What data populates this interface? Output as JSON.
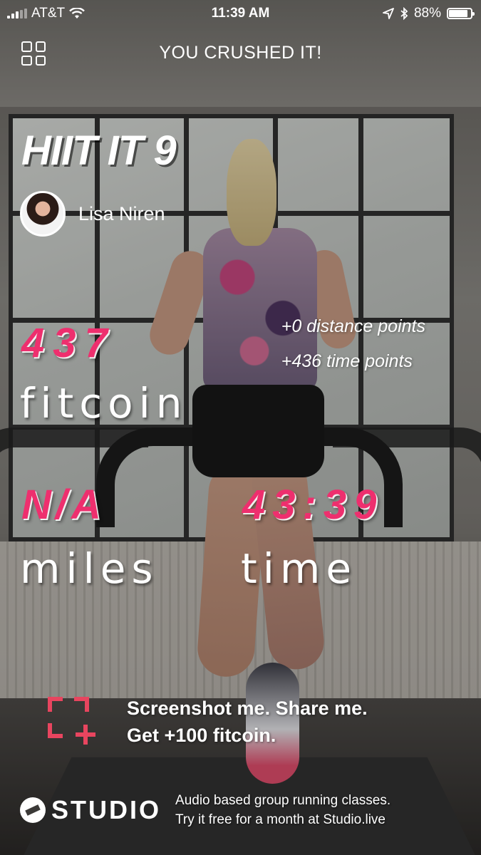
{
  "status_bar": {
    "carrier": "AT&T",
    "time": "11:39 AM",
    "battery": "88%",
    "battery_level": 0.88,
    "icons": [
      "signal-icon",
      "wifi-icon",
      "location-icon",
      "bluetooth-icon",
      "battery-icon"
    ]
  },
  "header": {
    "title": "YOU CRUSHED IT!",
    "menu_icon": "grid-icon"
  },
  "workout": {
    "class_name": "HIIT IT 9",
    "instructor": "Lisa Niren"
  },
  "stats": {
    "fitcoin_value": "437",
    "fitcoin_label": "fitcoin",
    "distance_points": "+0 distance points",
    "time_points": "+436 time points",
    "miles_value": "N/A",
    "miles_label": "miles",
    "time_value": "43:39",
    "time_label": "time"
  },
  "share": {
    "line1": "Screenshot me. Share me.",
    "line2": "Get +100 fitcoin."
  },
  "footer": {
    "brand": "STUDIO",
    "line1": "Audio based group running classes.",
    "line2": "Try it free for a month at Studio.live"
  },
  "colors": {
    "accent_pink": "#ee2f6e",
    "share_icon_red": "#e8455f",
    "text": "#ffffff"
  }
}
